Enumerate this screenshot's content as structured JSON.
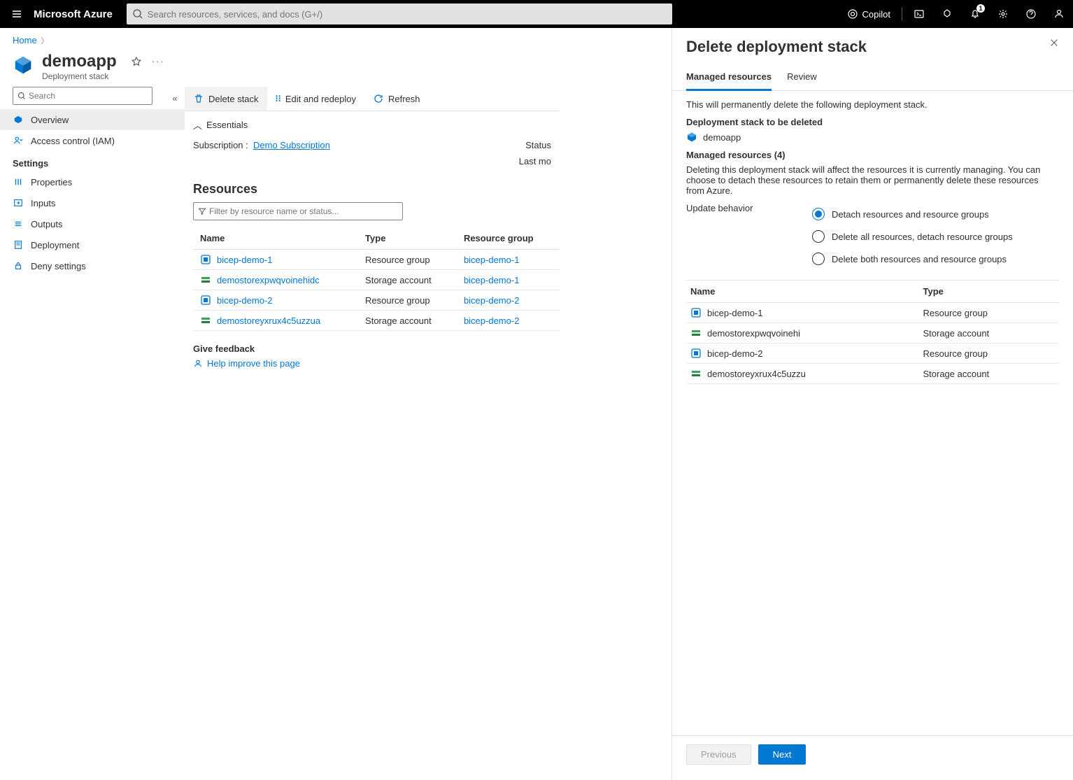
{
  "topbar": {
    "brand": "Microsoft Azure",
    "search_placeholder": "Search resources, services, and docs (G+/)",
    "copilot": "Copilot",
    "notification_count": "1"
  },
  "breadcrumb": {
    "home": "Home"
  },
  "header": {
    "title": "demoapp",
    "subtitle": "Deployment stack"
  },
  "sidebar": {
    "search_placeholder": "Search",
    "overview": "Overview",
    "iam": "Access control (IAM)",
    "settings_header": "Settings",
    "properties": "Properties",
    "inputs": "Inputs",
    "outputs": "Outputs",
    "deployment": "Deployment",
    "deny": "Deny settings"
  },
  "toolbar": {
    "delete": "Delete stack",
    "edit": "Edit and redeploy",
    "refresh": "Refresh"
  },
  "essentials": {
    "header": "Essentials",
    "subscription_label": "Subscription  :",
    "subscription_value": "Demo Subscription",
    "status_label": "Status",
    "lastmod_label": "Last mo"
  },
  "resources": {
    "title": "Resources",
    "filter_placeholder": "Filter by resource name or status...",
    "col_name": "Name",
    "col_type": "Type",
    "col_rg": "Resource group",
    "rows": [
      {
        "name": "bicep-demo-1",
        "type": "Resource group",
        "rg": "bicep-demo-1",
        "icon": "rg"
      },
      {
        "name": "demostorexpwqvoinehidc",
        "type": "Storage account",
        "rg": "bicep-demo-1",
        "icon": "storage"
      },
      {
        "name": "bicep-demo-2",
        "type": "Resource group",
        "rg": "bicep-demo-2",
        "icon": "rg"
      },
      {
        "name": "demostoreyxrux4c5uzzua",
        "type": "Storage account",
        "rg": "bicep-demo-2",
        "icon": "storage"
      }
    ]
  },
  "feedback": {
    "title": "Give feedback",
    "link": "Help improve this page"
  },
  "panel": {
    "title": "Delete deployment stack",
    "tab_managed": "Managed resources",
    "tab_review": "Review",
    "intro": "This will permanently delete the following deployment stack.",
    "sub_deleted": "Deployment stack to be deleted",
    "stack_name": "demoapp",
    "managed_header": "Managed resources (4)",
    "managed_para": "Deleting this deployment stack will affect the resources it is currently managing. You can choose to detach these resources to retain them or permanently delete these resources from Azure.",
    "update_label": "Update behavior",
    "radio1": "Detach resources and resource groups",
    "radio2": "Delete all resources, detach resource groups",
    "radio3": "Delete both resources and resource groups",
    "col_name": "Name",
    "col_type": "Type",
    "rows": [
      {
        "name": "bicep-demo-1",
        "type": "Resource group",
        "icon": "rg"
      },
      {
        "name": "demostorexpwqvoinehi",
        "type": "Storage account",
        "icon": "storage"
      },
      {
        "name": "bicep-demo-2",
        "type": "Resource group",
        "icon": "rg"
      },
      {
        "name": "demostoreyxrux4c5uzzu",
        "type": "Storage account",
        "icon": "storage"
      }
    ],
    "previous": "Previous",
    "next": "Next"
  }
}
